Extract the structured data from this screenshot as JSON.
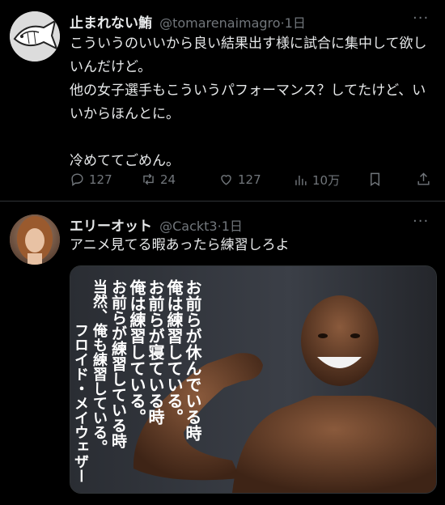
{
  "tweet1": {
    "display_name": "止まれない鮪",
    "handle": "@tomarenaimagro",
    "dot": "·",
    "time": "1日",
    "text": "こういうのいいから良い結果出す様に試合に集中して欲しいんだけど。\n他の女子選手もこういうパフォーマンス？してたけど、いいからほんとに。\n\n冷めててごめん。",
    "more": "···",
    "replies": "127",
    "retweets": "24",
    "likes": "127",
    "views": "10万"
  },
  "tweet2": {
    "display_name": "エリーオット",
    "handle": "@Cackt3",
    "dot": "·",
    "time": "1日",
    "text": "アニメ見てる暇あったら練習しろよ",
    "more": "···",
    "image_quote": {
      "line1": "お前らが休んでいる時",
      "line2": "俺は練習している。",
      "line3": "お前らが寝ている時",
      "line4": "俺は練習している。",
      "line5": "お前らが練習している時",
      "line6": "当然、俺も練習している。",
      "attribution": "フロイド・メイウェザー"
    }
  },
  "colors": {
    "background": "#000000",
    "text": "#e7e9ea",
    "muted": "#71767b",
    "divider": "#2f3336"
  }
}
